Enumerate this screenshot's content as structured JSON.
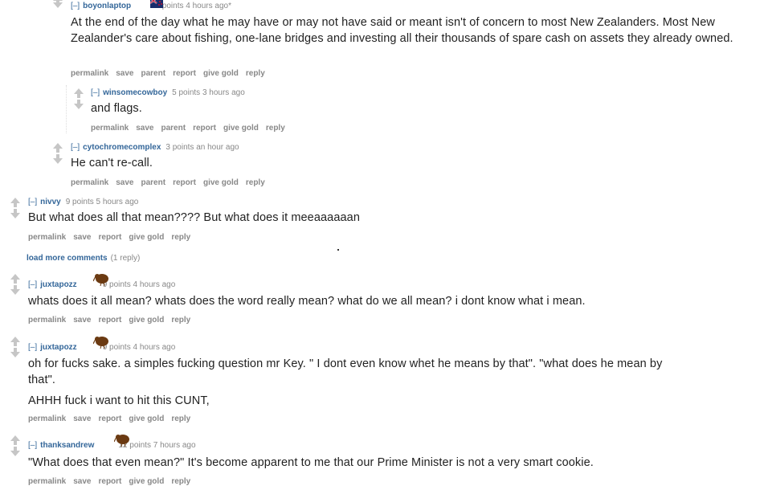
{
  "comments": [
    {
      "toggle": "[–]",
      "author": "boyonlaptop",
      "score": "12 points 4 hours ago*",
      "body": [
        "At the end of the day what he may have or may not have said or meant isn't of concern to most New Zealanders. Most New Zealander's care about fishing, one-lane bridges and investing all their thousands of spare cash on assets they already owned."
      ],
      "buttons": [
        "permalink",
        "save",
        "parent",
        "report",
        "give gold",
        "reply"
      ]
    },
    {
      "toggle": "[–]",
      "author": "winsomecowboy",
      "score": "5 points 3 hours ago",
      "body": [
        "and flags."
      ],
      "buttons": [
        "permalink",
        "save",
        "parent",
        "report",
        "give gold",
        "reply"
      ]
    },
    {
      "toggle": "[–]",
      "author": "cytochromecomplex",
      "score": "3 points an hour ago",
      "body": [
        "He can't re-call."
      ],
      "buttons": [
        "permalink",
        "save",
        "parent",
        "report",
        "give gold",
        "reply"
      ]
    },
    {
      "toggle": "[–]",
      "author": "nivvy",
      "score": "9 points 5 hours ago",
      "body": [
        "But what does all that mean???? But what does it meeaaaaaan"
      ],
      "buttons": [
        "permalink",
        "save",
        "report",
        "give gold",
        "reply"
      ]
    },
    {
      "toggle": "[–]",
      "author": "juxtapozz",
      "score": "9 points 4 hours ago",
      "body": [
        "whats does it all mean? whats does the word really mean? what do we all mean? i dont know what i mean."
      ],
      "buttons": [
        "permalink",
        "save",
        "report",
        "give gold",
        "reply"
      ]
    },
    {
      "toggle": "[–]",
      "author": "juxtapozz",
      "score": "9 points 4 hours ago",
      "body": [
        "oh for fucks sake. a simples fucking question mr Key. \" I dont even know whet he means by that\". \"what does he mean by that\".",
        "AHHH fuck i want to hit this CUNT,"
      ],
      "buttons": [
        "permalink",
        "save",
        "report",
        "give gold",
        "reply"
      ]
    },
    {
      "toggle": "[–]",
      "author": "thanksandrew",
      "score": "12 points 7 hours ago",
      "body": [
        "\"What does that even mean?\" It's become apparent to me that our Prime Minister is not a very smart cookie."
      ],
      "buttons": [
        "permalink",
        "save",
        "report",
        "give gold",
        "reply"
      ]
    }
  ],
  "load_more": {
    "link": "load more comments",
    "count": "(1 reply)"
  },
  "icons": {
    "flair_boyonlaptop": "nz-flag-icon",
    "flair_kiwi": "kiwi-bird-icon"
  },
  "colors": {
    "author": "#336699",
    "meta": "#888888",
    "arrow": "#c6c6c6",
    "kiwi": "#6b3a12"
  }
}
